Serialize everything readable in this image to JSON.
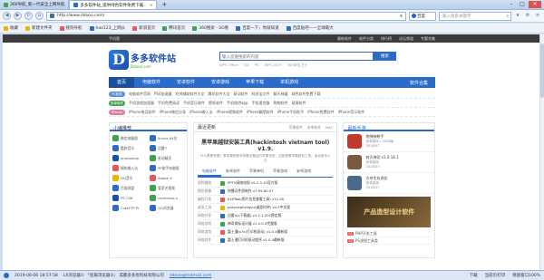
{
  "browser": {
    "tabs": [
      {
        "label": "360导航_新一代安全上网导航",
        "color": "#3fa34d"
      },
      {
        "label": "多多软件站_提供绿色软件免费下载..",
        "color": "#2b6bc9"
      }
    ],
    "address": "http://www.ddooo.com/",
    "engine": "百度",
    "search_placeholder": "输入搜索关键字",
    "favorites": [
      {
        "label": "收藏",
        "color": "#f0b400"
      },
      {
        "label": "新建文件夹",
        "color": "#f0b400"
      },
      {
        "label": "搜狗导航",
        "color": "#e55"
      },
      {
        "label": "hao123_上网从",
        "color": "#2b6bc9"
      },
      {
        "label": "新浪首页",
        "color": "#e55"
      },
      {
        "label": "腾讯首页",
        "color": "#3fa34d"
      },
      {
        "label": "360搜索 - SO看",
        "color": "#3fa34d"
      },
      {
        "label": "百度一下，你就知道",
        "color": "#2b6bc9"
      },
      {
        "label": "百度贴吧——全球最大",
        "color": "#2b6bc9"
      }
    ]
  },
  "site": {
    "topbar_left": "手机版",
    "topbar_links": [
      "最新软件",
      "软件分类",
      "排行榜",
      "论坛频道",
      "专题合集"
    ],
    "logo_letter": "D",
    "logo_cn": "多多软件站",
    "logo_en": "Ddooo.com",
    "search_placeholder": "输入您要搜索的内容",
    "search_button": "搜索",
    "hot_words": [
      "WPS Office",
      "QQ",
      "PS",
      "WPS 2019",
      "360安全卫士"
    ],
    "nav": [
      "首页",
      "电脑软件",
      "安卓软件",
      "安卓游戏",
      "苹果下载",
      "单机游戏"
    ],
    "nav_all": "软件合集",
    "cat_rows": [
      {
        "badge": "PC软件",
        "color": "#5b8fd8",
        "links": [
          "电脑软件官网",
          "PS6加速器",
          "吃鸡辅助软件大全",
          "腾讯软件大全",
          "驱动软件",
          "科技宝文件",
          "聊天神器",
          "绿色软件免费下载"
        ]
      },
      {
        "badge": "安卓软件",
        "color": "#3fa34d",
        "links": [
          "手机游戏加速器",
          "手机免费阅读",
          "手机音乐软件",
          "壁纸软件",
          "手机借贷app",
          "手机遥控器",
          "购物软件",
          "录屏软件"
        ]
      },
      {
        "badge": "iPhone",
        "color": "#e27c9d",
        "links": [
          "iPhone电话软件",
          "iPhone微信分身",
          "iPhone输入法",
          "iPhone视频软件",
          "iPhone翻墙软件",
          "iPhone手机助手",
          "iPhone免费软件",
          "iPhone音乐软件"
        ]
      }
    ],
    "left_col": {
      "title": "小编推荐",
      "items": [
        {
          "label": "微信电脑版",
          "color": "#3fa34d"
        },
        {
          "label": "itunes 64位",
          "color": "#2b6bc9"
        },
        {
          "label": "酷狗音乐",
          "color": "#2b6bc9"
        },
        {
          "label": "迅雷7",
          "color": "#2b6bc9"
        },
        {
          "label": "photoshop",
          "color": "#1a4fa8"
        },
        {
          "label": "驱动精灵",
          "color": "#3fa34d"
        },
        {
          "label": "搜狗输入法",
          "color": "#e55"
        },
        {
          "label": "PP助手电脑版",
          "color": "#2b6bc9"
        },
        {
          "label": "QQ音乐",
          "color": "#f0b400"
        },
        {
          "label": "Adobe X",
          "color": "#e55"
        },
        {
          "label": "百度网盘",
          "color": "#2b6bc9"
        },
        {
          "label": "爱奇艺视频",
          "color": "#3fa34d"
        },
        {
          "label": "PS CS6",
          "color": "#1a4fa8"
        },
        {
          "label": "coreldraw x",
          "color": "#3fa34d"
        },
        {
          "label": "CuteFTP Pr",
          "color": "#2b6bc9"
        },
        {
          "label": "QQ浏览器",
          "color": "#2b6bc9"
        }
      ]
    },
    "mid_col": {
      "title": "最近更新",
      "tabs": [
        "苹果软件",
        "安卓软件",
        "MAC"
      ],
      "headline": "黑苹果越狱安装工具(hackintosh vietnam tool) v1.9.",
      "subline": "什么是黑苹果？黑苹果就是非苹果设备运行苹果系统，这款是黑苹果越狱工具，适合新手小白",
      "subtabs": [
        "电脑软件",
        "安卓软件",
        "苹果单机",
        "苹果游戏",
        "安卓游戏"
      ],
      "rows": [
        {
          "cat": "视频播放",
          "name": "PPTV网络电视 v5.2.3.10官方版",
          "color": "#3fa34d"
        },
        {
          "cat": "图形图像",
          "name": "快播证件照制作 v7.95.60.07",
          "color": "#2b6bc9"
        },
        {
          "cat": "编程开发",
          "name": "ExifTool(照片信息查看工具) v11.00",
          "color": "#e55"
        },
        {
          "cat": "桌面工具",
          "name": "pasyuepilyhqyu(桌面时钟) v4.3中文版",
          "color": "#f0b400"
        },
        {
          "cat": "网络共享",
          "name": "迅雷x(x下载器) v1.2.1.201稳定版",
          "color": "#2b6bc9"
        },
        {
          "cat": "网络游戏",
          "name": "神奇商标设计器 v1.0.0.0完整版",
          "color": "#3fa34d"
        },
        {
          "cat": "网络游戏",
          "name": "富士通ip7x(打印机驱动) v1.0.4最新版",
          "color": "#e55"
        },
        {
          "cat": "网络软件",
          "name": "富士通打印机驱动程序 v1.0.4最新版",
          "color": "#2b6bc9"
        }
      ]
    },
    "right_col": {
      "title": "最新手游",
      "items": [
        {
          "name": "炮弹神射手",
          "meta": "安卓游戏 / 2018版",
          "date": "2018/07",
          "color": "#c0392b"
        },
        {
          "name": "寂灭神功 v1.0.14.1",
          "meta": "安卓游戏",
          "date": "2018/07",
          "color": "#7d5a3c"
        },
        {
          "name": "方舟生存进化",
          "meta": "安卓游戏",
          "date": "2018/07",
          "color": "#4a6b8a"
        }
      ],
      "promo": "产品造型设计软件",
      "list": [
        {
          "tag": "01",
          "label": "PHP开发工具"
        },
        {
          "tag": "02",
          "label": "PS滤镜工具类"
        }
      ]
    }
  },
  "status": {
    "time": "2019-06-06 18:57:58",
    "engine_note": "LX浏览器① 「星辰浏览器②」 成都多多优科技有限公司",
    "link": "ddooo@hotmail.com",
    "right_items": [
      "下载",
      "当前页打印",
      "保留窗口100%"
    ]
  }
}
